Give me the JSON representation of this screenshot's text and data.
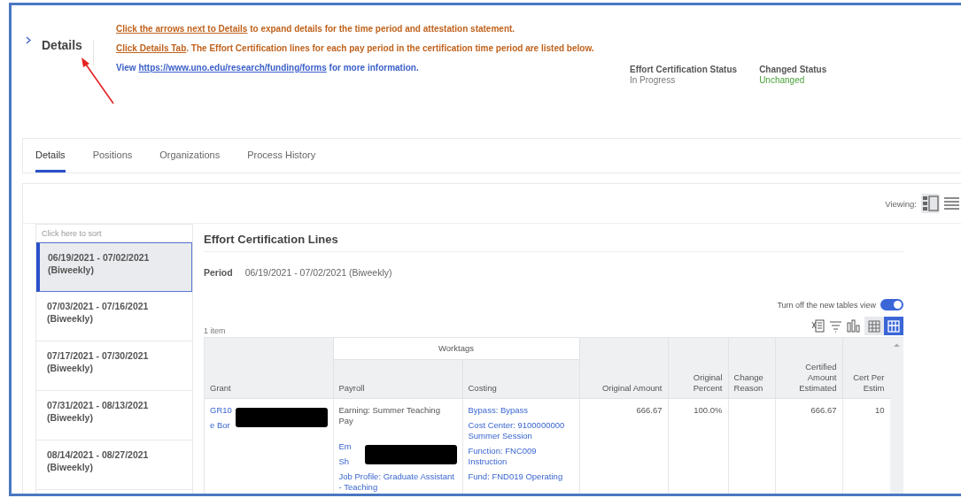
{
  "header": {
    "title": "Details",
    "instructions": [
      {
        "kind": "action",
        "link": "Click the arrows next to Details",
        "tail": " to expand details for the time period and attestation statement."
      },
      {
        "kind": "action",
        "link": "Click Details Tab",
        "tail": ". The Effort Certification lines for each pay period in the certification time period are listed below."
      },
      {
        "kind": "info",
        "lead": "View ",
        "link": "https://www.uno.edu/research/funding/forms",
        "tail": " for more information."
      }
    ],
    "statuses": [
      {
        "label": "Effort Certification Status",
        "value": "In Progress",
        "kind": "neutral"
      },
      {
        "label": "Changed Status",
        "value": "Unchanged",
        "kind": "positive"
      }
    ]
  },
  "tabs": [
    {
      "label": "Details",
      "selected": true
    },
    {
      "label": "Positions",
      "selected": false
    },
    {
      "label": "Organizations",
      "selected": false
    },
    {
      "label": "Process History",
      "selected": false
    }
  ],
  "viewing": {
    "label": "Viewing:",
    "options": [
      {
        "kind": "split",
        "selected": true
      },
      {
        "kind": "list",
        "selected": false
      }
    ]
  },
  "periods": {
    "sort_hint": "Click here to sort",
    "items": [
      {
        "range": "06/19/2021 - 07/02/2021",
        "frequency": "(Biweekly)",
        "selected": true
      },
      {
        "range": "07/03/2021 - 07/16/2021",
        "frequency": "(Biweekly)",
        "selected": false
      },
      {
        "range": "07/17/2021 - 07/30/2021",
        "frequency": "(Biweekly)",
        "selected": false
      },
      {
        "range": "07/31/2021 - 08/13/2021",
        "frequency": "(Biweekly)",
        "selected": false
      },
      {
        "range": "08/14/2021 - 08/27/2021",
        "frequency": "(Biweekly)",
        "selected": false
      }
    ]
  },
  "lines": {
    "title": "Effort Certification Lines",
    "period_label": "Period",
    "period_value": "06/19/2021 - 07/02/2021 (Biweekly)",
    "toggle": {
      "label": "Turn off the new tables view",
      "on": true
    },
    "count": "1 item",
    "view_modes": [
      {
        "kind": "grid",
        "selected": false
      },
      {
        "kind": "wide-grid",
        "selected": true
      }
    ],
    "table": {
      "header_rows": [
        [
          {
            "label": "Grant",
            "rowspan": 2
          },
          {
            "label": "Worktags",
            "colspan": 2
          },
          {
            "label": "Original Amount",
            "rowspan": 2
          },
          {
            "label": "Original Percent",
            "rowspan": 2
          },
          {
            "label": "Change Reason",
            "rowspan": 2
          },
          {
            "label": "Certified Amount Estimated",
            "rowspan": 2
          },
          {
            "label": "Cert Per Estim",
            "rowspan": 2
          }
        ],
        [
          {
            "label": "Payroll"
          },
          {
            "label": "Costing"
          }
        ]
      ],
      "rows": [
        {
          "cells": [
            {
              "kind": "stack",
              "items": [
                {
                  "kind": "redaction"
                },
                {
                  "kind": "link",
                  "text": "GR10"
                },
                {
                  "kind": "link",
                  "text": "e Bor"
                }
              ]
            },
            {
              "kind": "stack",
              "items": [
                {
                  "kind": "text",
                  "text": "Earning: Summer Teaching Pay"
                },
                {
                  "kind": "redaction"
                },
                {
                  "kind": "link",
                  "text": "Em"
                },
                {
                  "kind": "link",
                  "text": "Sh"
                },
                {
                  "kind": "link",
                  "text": "Job Profile: Graduate Assistant - Teaching"
                }
              ]
            },
            {
              "kind": "stack",
              "items": [
                {
                  "kind": "link",
                  "text": "Bypass: Bypass"
                },
                {
                  "kind": "link",
                  "text": "Cost Center: 9100000000 Summer Session"
                },
                {
                  "kind": "link",
                  "text": "Function: FNC009 Instruction"
                },
                {
                  "kind": "link",
                  "text": "Fund: FND019 Operating"
                }
              ]
            },
            {
              "kind": "number",
              "text": "666.67"
            },
            {
              "kind": "number",
              "text": "100.0%"
            },
            {
              "kind": "empty"
            },
            {
              "kind": "number",
              "text": "666.67"
            },
            {
              "kind": "number",
              "text": "10"
            }
          ]
        }
      ]
    }
  }
}
